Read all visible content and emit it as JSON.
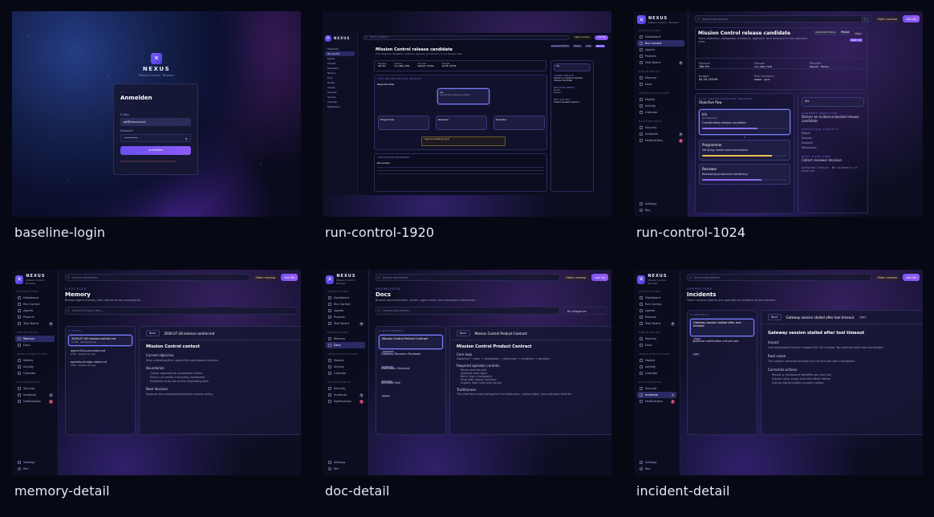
{
  "gallery": [
    {
      "caption": "baseline-login"
    },
    {
      "caption": "run-control-1920"
    },
    {
      "caption": "run-control-1024"
    },
    {
      "caption": "memory-detail"
    },
    {
      "caption": "doc-detail"
    },
    {
      "caption": "incident-detail"
    }
  ],
  "brand": {
    "name": "NEXUS",
    "subtitle": "Mission Control · Browser"
  },
  "login": {
    "title": "Anmelden",
    "email_label": "E-Mail",
    "email_value": "op@nexus.local",
    "password_label": "Passwort",
    "password_value": "••••••••",
    "submit": "Anmelden"
  },
  "app": {
    "search_placeholder": "Search operations",
    "kbd": "⌘K",
    "mockup_label": "Static mockup",
    "ask_label": "Ask Iris",
    "nav": {
      "sections": {
        "operations": "OPERATIONS",
        "knowledge": "KNOWLEDGE",
        "infrastructure": "INFRASTRUCTURE",
        "governance": "GOVERNANCE"
      },
      "dashboard": "Dashboard",
      "run_control": "Run Control",
      "agents": "Agents",
      "projects": "Projects",
      "task_board": "Task Board",
      "task_badge": "6",
      "memory": "Memory",
      "docs": "Docs",
      "models": "Models",
      "activity": "Activity",
      "calendar": "Calendar",
      "security": "Security",
      "incidents": "Incidents",
      "incidents_badge": "3",
      "notifications": "Notifications",
      "notifications_badge": "1",
      "settings": "Settings",
      "user": "Rex"
    }
  },
  "run": {
    "title": "Mission Control release candidate",
    "subtitle": "Trace objective, delegation, evidence, approval, and recovery in one operator view.",
    "pause": "Pause",
    "stop": "Stop",
    "fixture": "Authored Fixture",
    "elapsed_label": "Elapsed",
    "elapsed_value": "18s 4m",
    "session_label": "Session",
    "session_value": "run_date_7101",
    "provider_label": "Provider",
    "provider_value": "OpenAI · fixture",
    "budget_label": "Budget",
    "budget_value": "$1.24 / $5.00",
    "risk_label": "Risk boundary",
    "risk_value": "Gated · good",
    "live_label": "LIVE ORCHESTRATION MOCKUP",
    "flow_title": "Objective flow",
    "iris": "Iris",
    "iris_sub": "Orchestrator",
    "iris_task": "Coordinating release candidate",
    "programmer": "Programmer",
    "programmer_task": "Verifying routes and interactions",
    "reviewer": "Reviewer",
    "reviewer_task": "Reviewing production hardening",
    "evaluator": "Evaluator",
    "approval": "Approval awaiting input",
    "approval_sub": "Review budget, evidence, and rollback before Operator confirms",
    "timeline": "AUTHORITATIVE RUN TIMELINE",
    "run_events": "Run events",
    "current_objective_label": "CURRENT OBJECTIVE",
    "current_objective": "Deliver an evidence-backed release candidate",
    "exec_label": "EXECUTION CONTEXT",
    "model": "Model",
    "session": "Session",
    "elapsed": "Elapsed",
    "retrospect": "Retrospect",
    "next_label": "NEXT SAFE STEP",
    "next_step": "Collect reviewer decision",
    "fixture_note": "Authored fixture. No telemetry or external"
  },
  "memory": {
    "eyebrow": "LIFECYCLE",
    "title": "Memory",
    "subtitle": "Browse agent memory files stored across workspaces.",
    "search": "Search memory files...",
    "files_label": "3 FILES",
    "files": [
      {
        "name": "2026-07-28 mission-control.md",
        "meta": "12 KB · updated today"
      },
      {
        "name": "agent-first-principles.md",
        "meta": "8 KB · updated 2d ago"
      },
      {
        "name": "operator-bridge-notes.md",
        "meta": "4 KB · updated 5d ago"
      }
    ],
    "back": "Back",
    "doc_title": "2026-07-28 mission-control.md",
    "heading": "Mission Control context",
    "sec1": "Current objective",
    "sec1_body": "Ship a desktop-first, agent-first operational surface.",
    "sec2": "Boundaries",
    "bullets": [
      "Owner approval for production writes",
      "Every run needs a recovery checkpoint",
      "Evidence must link to the originating task"
    ],
    "sec3": "Next decision",
    "sec3_body": "Approve the proposed production access policy."
  },
  "docs": {
    "eyebrow": "KNOWLEDGE",
    "title": "Docs",
    "subtitle": "Browse documentation, health, agent skills, and workspace references.",
    "search": "Search documents...",
    "category": "All categories",
    "count_label": "4 DOCUMENTS",
    "items": [
      {
        "name": "Mission Control Product Contract",
        "tag": "PRODUCT"
      },
      {
        "name": "Gateway Recovery Runbook",
        "tag": "RUNBOOK"
      },
      {
        "name": "Evaluation Checklist",
        "tag": "PROCESS"
      },
      {
        "name": "Reviewer Skill",
        "tag": "SKILLS"
      }
    ],
    "back": "Back",
    "doc_title": "Mission Control Product Contract",
    "heading": "Mission Control Product Contract",
    "sec1": "Core loop",
    "sec1_body": "Objective → plan → delegation → execution → evidence → decision.",
    "sec2": "Required operator controls",
    "bullets": [
      "Pause and resume",
      "Approve and reject",
      "Retry from checkpoint",
      "Stop with impact preview",
      "Inspect Task calls and results"
    ],
    "sec3": "Truthfulness",
    "sec3_body": "The interface must distinguish live telemetry, cached data, and authored fixtures."
  },
  "incidents": {
    "eyebrow": "OPERATIONS",
    "title": "Incidents",
    "subtitle": "Track incident reports and operational incidents across Nexeris.",
    "count_label": "2 REPORTS",
    "items": [
      {
        "name": "Gateway session stalled after tool timeout",
        "tag": "HIGH"
      },
      {
        "name": "Approval notification arrived late",
        "tag": "LOW"
      }
    ],
    "back": "Back",
    "detail_title": "Gateway session stalled after tool timeout",
    "severity": "HIGH",
    "heading": "Gateway session stalled after tool timeout",
    "sec1": "Impact",
    "sec1_body": "One operational branch stopped for 18 minutes. No external write was duplicated.",
    "sec2": "Root cause",
    "sec2_body": "The session resumed activity but not the last safe checkpoint.",
    "sec3": "Corrective actions",
    "bullets": [
      "Persist a checkpoint identifier per tool call",
      "Expose retry scope and side-effect status",
      "Add an owner-visible recovery action"
    ]
  }
}
